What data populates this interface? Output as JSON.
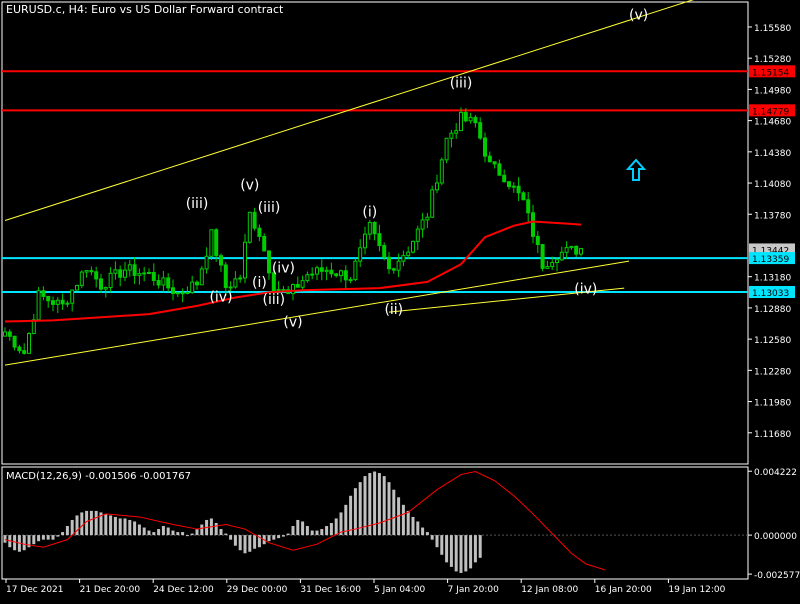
{
  "header": {
    "title": "EURUSD.c, H4:  Euro vs US Dollar Forward contract",
    "macd_label": "MACD(12,26,9) -0.001506 -0.001767"
  },
  "colors": {
    "background": "#000000",
    "frame": "#ffffff",
    "candle": "#00cc00",
    "ma": "#ff0000",
    "hline_red": "#ff0000",
    "hline_cyan": "#00e5ff",
    "channel": "#ffff33",
    "macd_hist": "#c0c0c0",
    "macd_signal": "#ff0000",
    "arrow": "#00ccff",
    "wave_label": "#ffffff"
  },
  "icons": {
    "arrow": "up-arrow-icon"
  },
  "chart_data": [
    {
      "type": "candlestick",
      "ylim": [
        1.1138,
        1.1582
      ],
      "y_ticks": [
        "1.15580",
        "1.15280",
        "1.14980",
        "1.14680",
        "1.14380",
        "1.14080",
        "1.13780",
        "1.13180",
        "1.12880",
        "1.12580",
        "1.12280",
        "1.11980",
        "1.11680"
      ],
      "x_labels": [
        "17 Dec 2021",
        "21 Dec 20:00",
        "24 Dec 12:00",
        "29 Dec 00:00",
        "31 Dec 16:00",
        "5 Jan 04:00",
        "7 Jan 20:00",
        "12 Jan 08:00",
        "16 Jan 20:00",
        "19 Jan 12:00"
      ],
      "price_badges": [
        {
          "label": "1.15154",
          "value": 1.15154,
          "color": "#ff0000"
        },
        {
          "label": "1.14779",
          "value": 1.14779,
          "color": "#ff0000"
        },
        {
          "label": "1.13442",
          "value": 1.13442,
          "color": "#c8c8c8"
        },
        {
          "label": "1.13359",
          "value": 1.13359,
          "color": "#00e5ff"
        },
        {
          "label": "1.13033",
          "value": 1.13033,
          "color": "#00e5ff"
        }
      ],
      "horizontal_lines": [
        {
          "value": 1.15154,
          "color": "#ff0000"
        },
        {
          "value": 1.14779,
          "color": "#ff0000"
        },
        {
          "value": 1.13359,
          "color": "#00e5ff"
        },
        {
          "value": 1.13033,
          "color": "#00e5ff"
        }
      ],
      "trendlines": [
        {
          "x": [
            0,
            150
          ],
          "y": [
            1.1372,
            1.1594
          ]
        },
        {
          "x": [
            0,
            130
          ],
          "y": [
            1.1233,
            1.1333
          ]
        },
        {
          "x": [
            80,
            129
          ],
          "y": [
            1.1284,
            1.1307
          ]
        }
      ],
      "ma_points": [
        [
          0,
          1.1275
        ],
        [
          10,
          1.1276
        ],
        [
          30,
          1.1282
        ],
        [
          40,
          1.129
        ],
        [
          48,
          1.1298
        ],
        [
          55,
          1.1303
        ],
        [
          62,
          1.1305
        ],
        [
          78,
          1.1307
        ],
        [
          88,
          1.1313
        ],
        [
          95,
          1.133
        ],
        [
          100,
          1.1356
        ],
        [
          106,
          1.1367
        ],
        [
          110,
          1.1371
        ],
        [
          117,
          1.1369
        ],
        [
          120,
          1.1368
        ]
      ],
      "candle_anchors": [
        [
          0,
          1.1265
        ],
        [
          4,
          1.1245
        ],
        [
          7,
          1.13
        ],
        [
          12,
          1.129
        ],
        [
          17,
          1.1328
        ],
        [
          20,
          1.131
        ],
        [
          25,
          1.1325
        ],
        [
          30,
          1.132
        ],
        [
          36,
          1.1302
        ],
        [
          40,
          1.1312
        ],
        [
          43,
          1.1358
        ],
        [
          46,
          1.1308
        ],
        [
          49,
          1.1318
        ],
        [
          51,
          1.1378
        ],
        [
          53,
          1.136
        ],
        [
          56,
          1.131
        ],
        [
          59,
          1.13
        ],
        [
          63,
          1.132
        ],
        [
          67,
          1.1325
        ],
        [
          72,
          1.1318
        ],
        [
          76,
          1.1365
        ],
        [
          80,
          1.1325
        ],
        [
          84,
          1.1345
        ],
        [
          88,
          1.1378
        ],
        [
          92,
          1.145
        ],
        [
          95,
          1.147
        ],
        [
          98,
          1.1465
        ],
        [
          101,
          1.1425
        ],
        [
          104,
          1.1415
        ],
        [
          108,
          1.139
        ],
        [
          112,
          1.133
        ],
        [
          115,
          1.134
        ],
        [
          120,
          1.1345
        ]
      ],
      "wave_labels": [
        {
          "text": "(iii)",
          "x": 40,
          "y": 1.1384
        },
        {
          "text": "(v)",
          "x": 51,
          "y": 1.1402
        },
        {
          "text": "(iii)",
          "x": 55,
          "y": 1.138
        },
        {
          "text": "(i)",
          "x": 53,
          "y": 1.1308
        },
        {
          "text": "(iv)",
          "x": 58,
          "y": 1.1322
        },
        {
          "text": "(iv)",
          "x": 45,
          "y": 1.1294
        },
        {
          "text": "(iii)",
          "x": 56,
          "y": 1.1292
        },
        {
          "text": "(v)",
          "x": 60,
          "y": 1.127
        },
        {
          "text": "(i)",
          "x": 76,
          "y": 1.1376
        },
        {
          "text": "(ii)",
          "x": 81,
          "y": 1.1282
        },
        {
          "text": "(iii)",
          "x": 95,
          "y": 1.15
        },
        {
          "text": "(v)",
          "x": 132,
          "y": 1.1565
        },
        {
          "text": "(iv)",
          "x": 121,
          "y": 1.1302
        }
      ]
    },
    {
      "type": "bar",
      "ylim": [
        -0.0029,
        0.0045
      ],
      "y_ticks": [
        "0.004222",
        "0.000000",
        "-0.002577"
      ],
      "histogram": [
        -0.0005,
        -0.0008,
        -0.001,
        -0.0011,
        -0.001,
        -0.0008,
        -0.0006,
        -0.0004,
        -0.0003,
        -0.0003,
        -0.0003,
        -0.0001,
        0.0002,
        0.0006,
        0.001,
        0.0013,
        0.0015,
        0.0016,
        0.0016,
        0.0016,
        0.0015,
        0.0014,
        0.0013,
        0.0012,
        0.0011,
        0.0011,
        0.001,
        0.0009,
        0.0007,
        0.0005,
        0.0003,
        0.0002,
        0.0004,
        0.0006,
        0.0005,
        0.0003,
        0.0002,
        0.0002,
        0.0,
        0.0001,
        0.0004,
        0.0007,
        0.001,
        0.0011,
        0.0008,
        0.0004,
        0.0001,
        -0.0003,
        -0.0007,
        -0.001,
        -0.0012,
        -0.0011,
        -0.0009,
        -0.0008,
        -0.0006,
        -0.0004,
        -0.0003,
        -0.0002,
        -0.0001,
        0.0001,
        0.0006,
        0.001,
        0.0009,
        0.0006,
        0.0003,
        0.0003,
        0.0004,
        0.0006,
        0.0008,
        0.0011,
        0.0015,
        0.002,
        0.0026,
        0.0031,
        0.0035,
        0.0039,
        0.0041,
        0.0042,
        0.0041,
        0.0039,
        0.0035,
        0.003,
        0.0025,
        0.002,
        0.0016,
        0.0012,
        0.0009,
        0.0005,
        0.0002,
        -0.0003,
        -0.0008,
        -0.0013,
        -0.0018,
        -0.0021,
        -0.0024,
        -0.0025,
        -0.0024,
        -0.0022,
        -0.0018,
        -0.0015
      ],
      "signal_points": [
        [
          0,
          -0.0003
        ],
        [
          4,
          -0.0006
        ],
        [
          8,
          -0.0008
        ],
        [
          13,
          -0.0003
        ],
        [
          17,
          0.0009
        ],
        [
          21,
          0.0014
        ],
        [
          28,
          0.0012
        ],
        [
          35,
          0.0007
        ],
        [
          40,
          0.0004
        ],
        [
          46,
          0.0007
        ],
        [
          50,
          0.0004
        ],
        [
          55,
          -0.0005
        ],
        [
          60,
          -0.001
        ],
        [
          65,
          -0.0006
        ],
        [
          70,
          0.0002
        ],
        [
          73,
          0.0004
        ],
        [
          78,
          0.0008
        ],
        [
          84,
          0.0015
        ],
        [
          90,
          0.003
        ],
        [
          95,
          0.004
        ],
        [
          98,
          0.0042
        ],
        [
          102,
          0.0036
        ],
        [
          106,
          0.0026
        ],
        [
          110,
          0.0014
        ],
        [
          114,
          0.0001
        ],
        [
          118,
          -0.0012
        ],
        [
          121,
          -0.0019
        ],
        [
          125,
          -0.0023
        ]
      ]
    }
  ]
}
